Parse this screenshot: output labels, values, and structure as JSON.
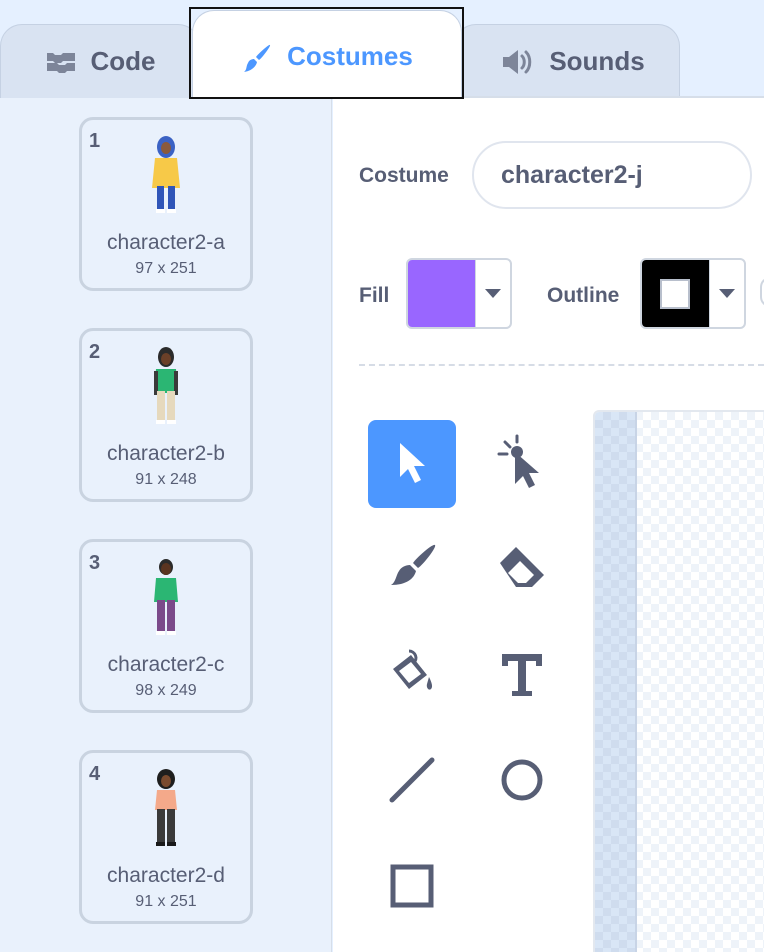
{
  "tabs": [
    {
      "label": "Code",
      "icon": "code-blocks-icon"
    },
    {
      "label": "Costumes",
      "icon": "paintbrush-icon",
      "active": true
    },
    {
      "label": "Sounds",
      "icon": "speaker-icon"
    }
  ],
  "costumes": [
    {
      "number": "1",
      "name": "character2-a",
      "size": "97 x 251"
    },
    {
      "number": "2",
      "name": "character2-b",
      "size": "91 x 248"
    },
    {
      "number": "3",
      "name": "character2-c",
      "size": "98 x 249"
    },
    {
      "number": "4",
      "name": "character2-d",
      "size": "91 x 251"
    }
  ],
  "editor": {
    "costume_label": "Costume",
    "costume_name": "character2-j",
    "fill_label": "Fill",
    "outline_label": "Outline",
    "fill_color": "#9966ff",
    "outline_color": "#000000"
  },
  "tools": [
    {
      "icon": "select-arrow-icon",
      "selected": true
    },
    {
      "icon": "reshape-icon"
    },
    {
      "icon": "brush-icon"
    },
    {
      "icon": "eraser-icon"
    },
    {
      "icon": "fill-bucket-icon"
    },
    {
      "icon": "text-icon"
    },
    {
      "icon": "line-icon"
    },
    {
      "icon": "circle-icon"
    },
    {
      "icon": "rectangle-icon"
    }
  ],
  "colors": {
    "accent": "#4c97ff",
    "text": "#575e75",
    "panel_bg": "#e9f1fc"
  }
}
